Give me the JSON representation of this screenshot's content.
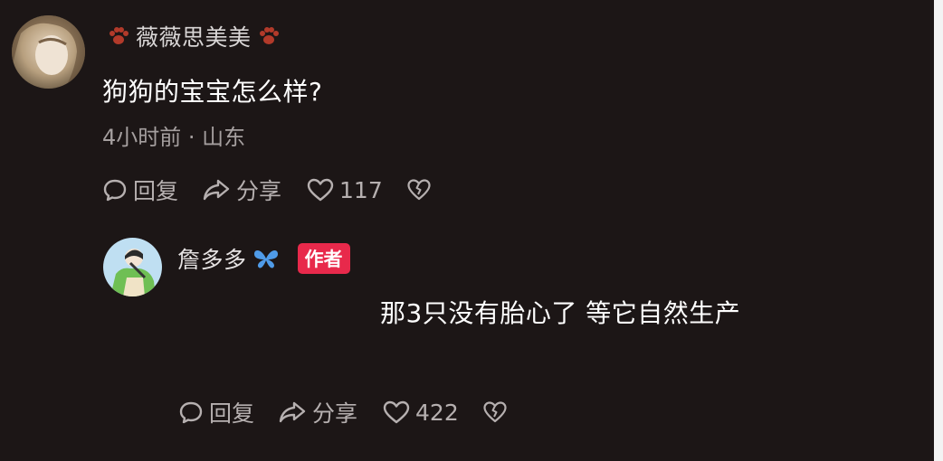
{
  "comment": {
    "username": "薇薇思美美",
    "text": "狗狗的宝宝怎么样?",
    "meta": "4小时前 · 山东",
    "actions": {
      "reply_label": "回复",
      "share_label": "分享",
      "like_count": "117"
    },
    "icons": [
      "paw-icon",
      "comment-icon",
      "share-icon",
      "heart-icon",
      "dislike-heart-icon"
    ]
  },
  "reply": {
    "username": "詹多多",
    "badge": "作者",
    "text": "那3只没有胎心了 等它自然生产",
    "actions": {
      "reply_label": "回复",
      "share_label": "分享",
      "like_count": "422"
    },
    "icons": [
      "butterfly-icon",
      "comment-icon",
      "share-icon",
      "heart-icon",
      "dislike-heart-icon"
    ]
  },
  "colors": {
    "background": "#1c1616",
    "text_primary": "#ffffff",
    "text_secondary": "#a59f9f",
    "badge": "#e8294b",
    "paw": "#b23a2a",
    "butterfly": "#4f9be8"
  }
}
